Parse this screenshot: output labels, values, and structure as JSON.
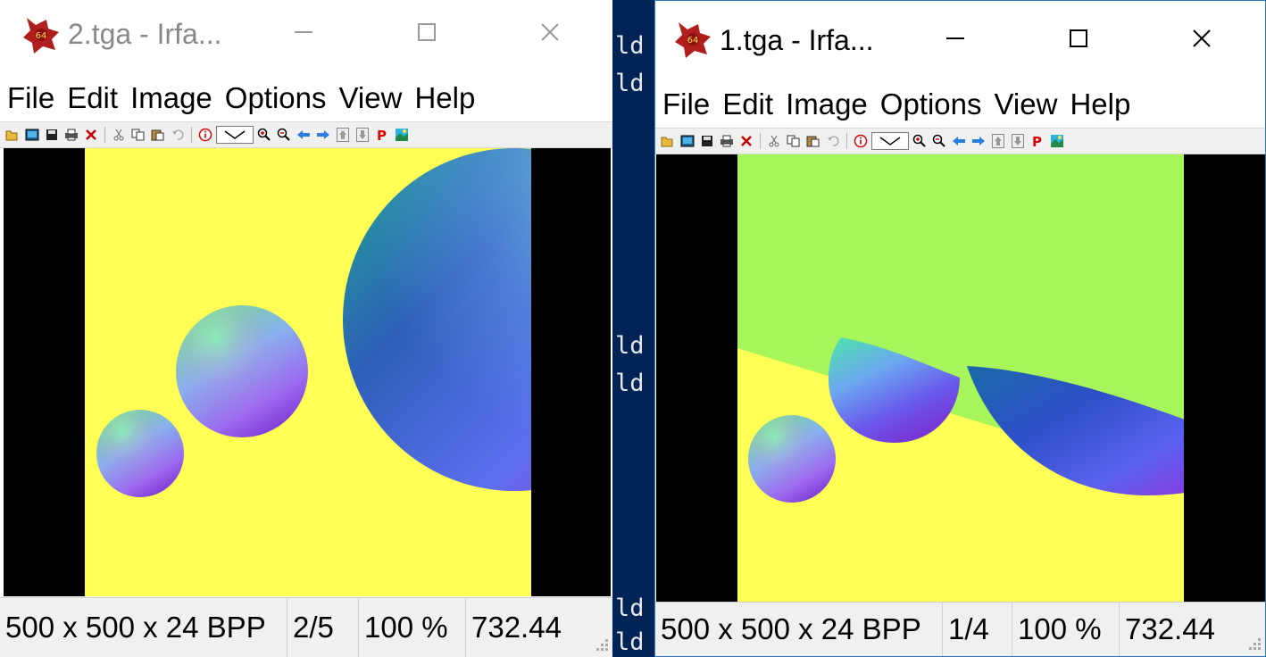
{
  "background_terminal": {
    "text_fragments": [
      "ld",
      "ld",
      "ld",
      "ld",
      "ld",
      "ld"
    ]
  },
  "windows": [
    {
      "id": "win2",
      "title": "2.tga - Irfa...",
      "active": false,
      "menu": [
        "File",
        "Edit",
        "Image",
        "Options",
        "View",
        "Help"
      ],
      "status": {
        "dimensions": "500 x 500 x 24 BPP",
        "index": "2/5",
        "zoom": "100 %",
        "value": "732.44"
      },
      "image_colors": {
        "background": "#ffff55"
      }
    },
    {
      "id": "win1",
      "title": "1.tga - Irfa...",
      "active": true,
      "menu": [
        "File",
        "Edit",
        "Image",
        "Options",
        "View",
        "Help"
      ],
      "status": {
        "dimensions": "500 x 500 x 24 BPP",
        "index": "1/4",
        "zoom": "100 %",
        "value": "732.44"
      },
      "image_colors": {
        "top": "#a6f55a",
        "bottom": "#ffff55"
      }
    }
  ],
  "icons": [
    "app-icon",
    "minimize-icon",
    "maximize-icon",
    "close-icon",
    "open-icon",
    "thumbnails-icon",
    "save-icon",
    "print-icon",
    "delete-icon",
    "cut-icon",
    "copy-icon",
    "paste-icon",
    "undo-icon",
    "info-icon",
    "zoom-in-icon",
    "zoom-out-icon",
    "prev-icon",
    "next-icon",
    "up-icon",
    "down-icon",
    "paint-icon",
    "slideshow-icon",
    "resize-grip-icon"
  ]
}
